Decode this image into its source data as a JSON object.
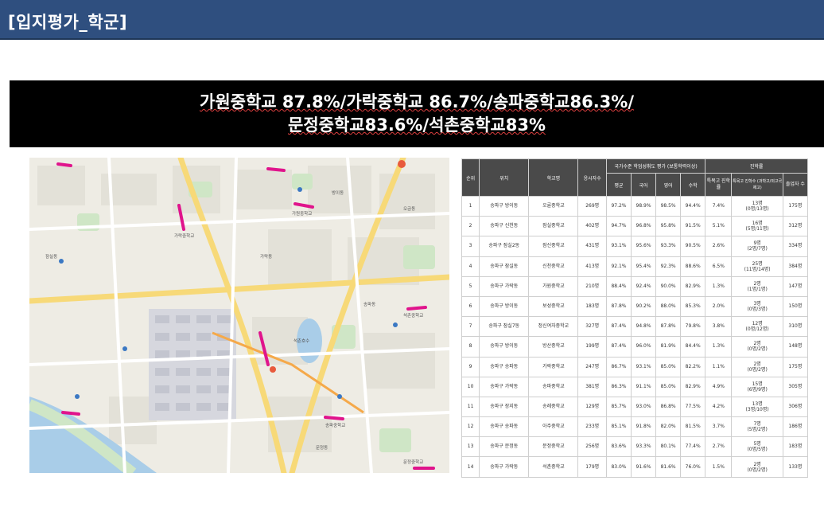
{
  "header": {
    "title": "[입지평가_학군]"
  },
  "banner": {
    "line1": "가원중학교 87.8%/가락중학교 86.7%/송파중학교86.3%/",
    "line2": "문정중학교83.6%/석촌중학교83%"
  },
  "map": {
    "labels": [
      "가락동",
      "문정동",
      "송파동",
      "오금동",
      "방이동",
      "잠실동",
      "석촌호수",
      "가원중학교",
      "송파중학교",
      "가락중학교",
      "문정중학교",
      "석촌중학교"
    ]
  },
  "table": {
    "headers": {
      "rank": "순위",
      "location": "위치",
      "school": "학교명",
      "applicants": "응시자수",
      "national": "국가수준 학업성취도 평가 (보통학력이상)",
      "advance": "진학률",
      "avg": "평균",
      "korean": "국어",
      "english": "영어",
      "math": "수학",
      "special": "특목고 진학률",
      "special_count": "특목고 진학수 (과학고/외고국제고)",
      "grads": "졸업자 수"
    },
    "rows": [
      {
        "rank": "1",
        "loc": "송파구 방이동",
        "school": "오륜중학교",
        "n": "269명",
        "avg": "97.2%",
        "kor": "98.9%",
        "eng": "98.5%",
        "math": "94.4%",
        "sp": "7.4%",
        "cnt1": "13명",
        "cnt2": "(0명/13명)",
        "grad": "175명"
      },
      {
        "rank": "2",
        "loc": "송파구 신천동",
        "school": "잠실중학교",
        "n": "402명",
        "avg": "94.7%",
        "kor": "96.8%",
        "eng": "95.8%",
        "math": "91.5%",
        "sp": "5.1%",
        "cnt1": "16명",
        "cnt2": "(5명/11명)",
        "grad": "312명"
      },
      {
        "rank": "3",
        "loc": "송파구 잠실2동",
        "school": "잠신중학교",
        "n": "431명",
        "avg": "93.1%",
        "kor": "95.6%",
        "eng": "93.3%",
        "math": "90.5%",
        "sp": "2.6%",
        "cnt1": "9명",
        "cnt2": "(2명/7명)",
        "grad": "334명"
      },
      {
        "rank": "4",
        "loc": "송파구 잠실동",
        "school": "신천중학교",
        "n": "413명",
        "avg": "92.1%",
        "kor": "95.4%",
        "eng": "92.3%",
        "math": "88.6%",
        "sp": "6.5%",
        "cnt1": "25명",
        "cnt2": "(11명/14명)",
        "grad": "384명"
      },
      {
        "rank": "5",
        "loc": "송파구 가락동",
        "school": "가원중학교",
        "n": "210명",
        "avg": "88.4%",
        "kor": "92.4%",
        "eng": "90.0%",
        "math": "82.9%",
        "sp": "1.3%",
        "cnt1": "2명",
        "cnt2": "(1명/1명)",
        "grad": "147명"
      },
      {
        "rank": "6",
        "loc": "송파구 방이동",
        "school": "보성중학교",
        "n": "183명",
        "avg": "87.8%",
        "kor": "90.2%",
        "eng": "88.0%",
        "math": "85.3%",
        "sp": "2.0%",
        "cnt1": "3명",
        "cnt2": "(0명/3명)",
        "grad": "150명"
      },
      {
        "rank": "7",
        "loc": "송파구 잠실7동",
        "school": "정신여자중학교",
        "n": "327명",
        "avg": "87.4%",
        "kor": "94.8%",
        "eng": "87.8%",
        "math": "79.8%",
        "sp": "3.8%",
        "cnt1": "12명",
        "cnt2": "(0명/12명)",
        "grad": "310명"
      },
      {
        "rank": "8",
        "loc": "송파구 방이동",
        "school": "방산중학교",
        "n": "199명",
        "avg": "87.4%",
        "kor": "96.0%",
        "eng": "81.9%",
        "math": "84.4%",
        "sp": "1.3%",
        "cnt1": "2명",
        "cnt2": "(0명/2명)",
        "grad": "148명"
      },
      {
        "rank": "9",
        "loc": "송파구 송파동",
        "school": "가락중학교",
        "n": "247명",
        "avg": "86.7%",
        "kor": "93.1%",
        "eng": "85.0%",
        "math": "82.2%",
        "sp": "1.1%",
        "cnt1": "2명",
        "cnt2": "(0명/2명)",
        "grad": "175명"
      },
      {
        "rank": "10",
        "loc": "송파구 가락동",
        "school": "송파중학교",
        "n": "381명",
        "avg": "86.3%",
        "kor": "91.1%",
        "eng": "85.0%",
        "math": "82.9%",
        "sp": "4.9%",
        "cnt1": "15명",
        "cnt2": "(6명/9명)",
        "grad": "305명"
      },
      {
        "rank": "11",
        "loc": "송파구 장지동",
        "school": "송례중학교",
        "n": "129명",
        "avg": "85.7%",
        "kor": "93.0%",
        "eng": "86.8%",
        "math": "77.5%",
        "sp": "4.2%",
        "cnt1": "13명",
        "cnt2": "(3명/10명)",
        "grad": "306명"
      },
      {
        "rank": "12",
        "loc": "송파구 송파동",
        "school": "아주중학교",
        "n": "233명",
        "avg": "85.1%",
        "kor": "91.8%",
        "eng": "82.0%",
        "math": "81.5%",
        "sp": "3.7%",
        "cnt1": "7명",
        "cnt2": "(5명/2명)",
        "grad": "186명"
      },
      {
        "rank": "13",
        "loc": "송파구 문정동",
        "school": "문정중학교",
        "n": "256명",
        "avg": "83.6%",
        "kor": "93.3%",
        "eng": "80.1%",
        "math": "77.4%",
        "sp": "2.7%",
        "cnt1": "5명",
        "cnt2": "(0명/5명)",
        "grad": "183명"
      },
      {
        "rank": "14",
        "loc": "송파구 가락동",
        "school": "석촌중학교",
        "n": "179명",
        "avg": "83.0%",
        "kor": "91.6%",
        "eng": "81.6%",
        "math": "76.0%",
        "sp": "1.5%",
        "cnt1": "2명",
        "cnt2": "(0명/2명)",
        "grad": "133명"
      }
    ]
  }
}
